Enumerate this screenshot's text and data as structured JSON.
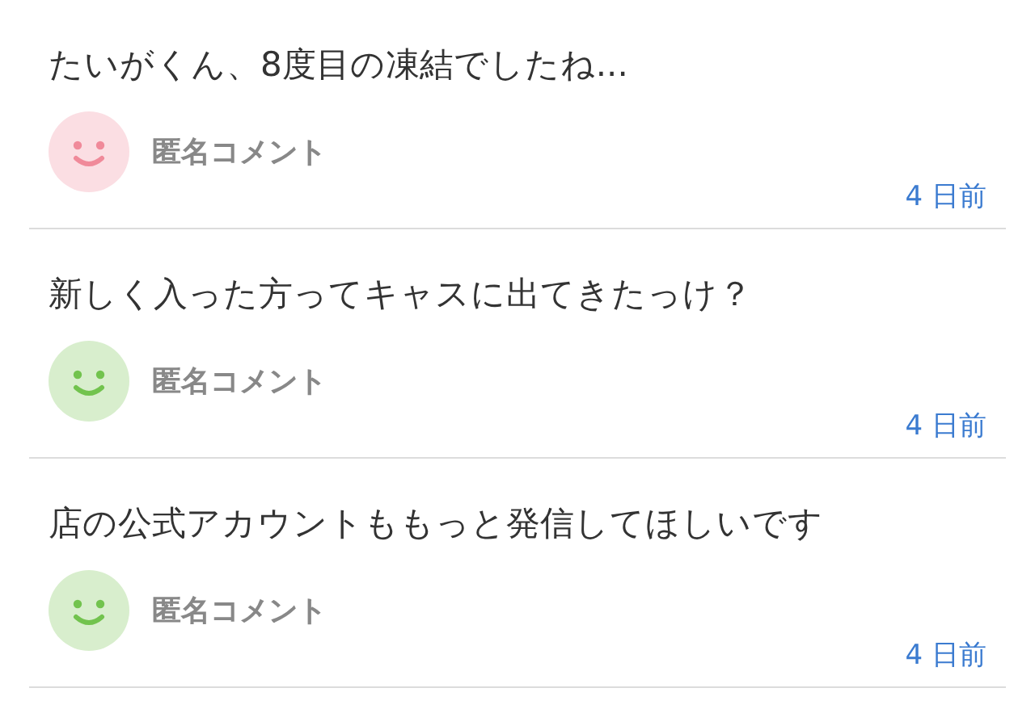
{
  "comments": [
    {
      "text": "たいがくん、8度目の凍結でしたね...",
      "author": "匿名コメント",
      "time": "4 日前",
      "color": "#f08a9a"
    },
    {
      "text": "新しく入った方ってキャスに出てきたっけ？",
      "author": "匿名コメント",
      "time": "4 日前",
      "color": "#72c34e"
    },
    {
      "text": "店の公式アカウントももっと発信してほしいです",
      "author": "匿名コメント",
      "time": "4 日前",
      "color": "#72c34e"
    }
  ]
}
